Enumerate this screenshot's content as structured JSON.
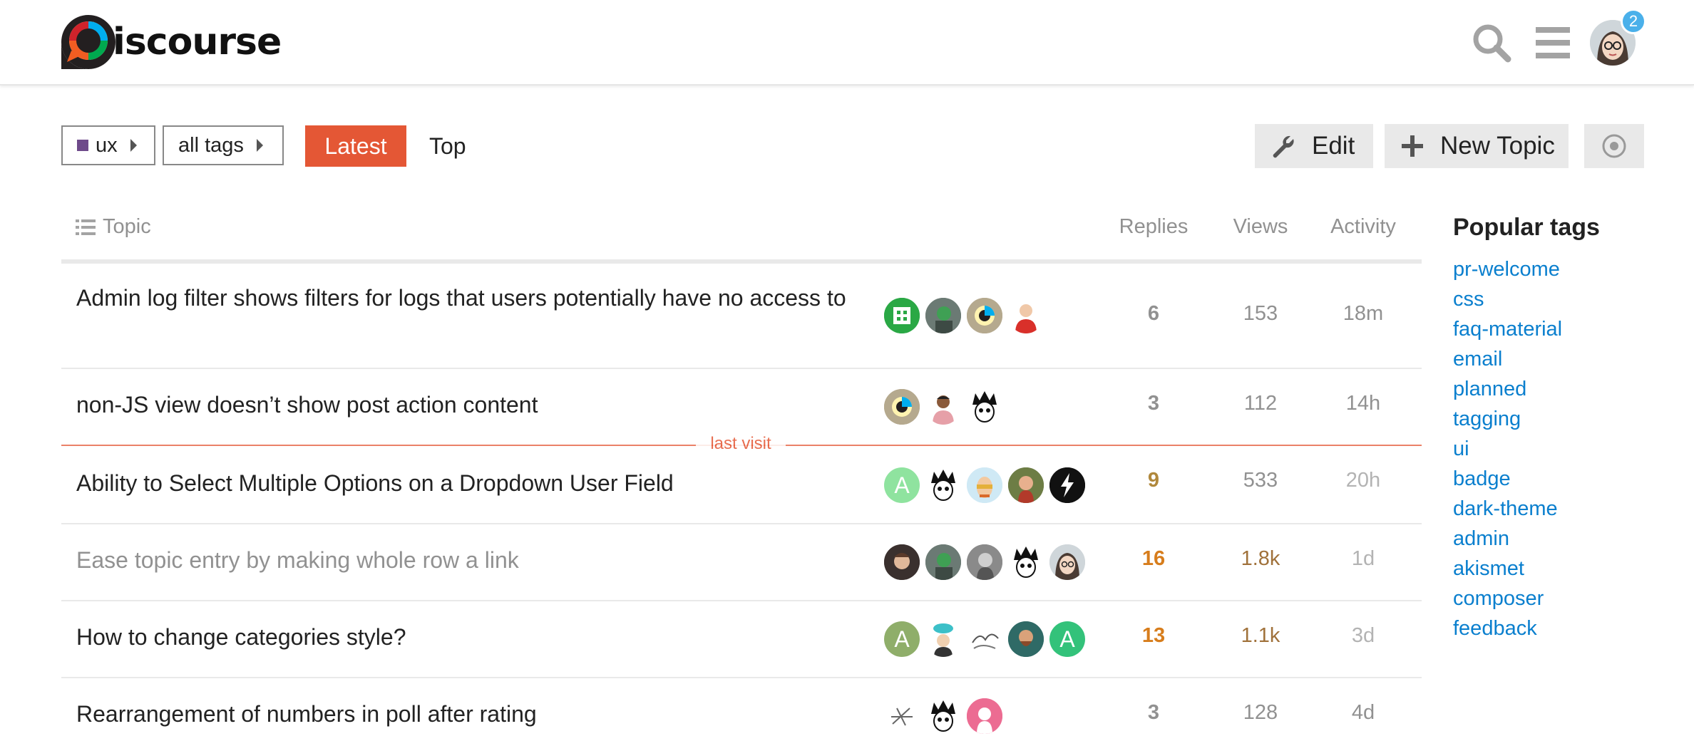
{
  "header": {
    "logo_text": "iscourse",
    "notification_count": "2",
    "icons": [
      "search-icon",
      "hamburger-menu-icon",
      "user-avatar"
    ]
  },
  "nav": {
    "category_filter": "ux",
    "category_color": "#6e4a8a",
    "tag_filter": "all tags",
    "tabs": [
      {
        "label": "Latest",
        "active": true
      },
      {
        "label": "Top",
        "active": false
      }
    ],
    "edit_label": "Edit",
    "new_topic_label": "New Topic"
  },
  "table": {
    "headers": {
      "topic": "Topic",
      "replies": "Replies",
      "views": "Views",
      "activity": "Activity"
    },
    "last_visit_label": "last visit",
    "rows": [
      {
        "title": "Admin log filter shows filters for logs that users potentially have no access to",
        "replies": "6",
        "views": "153",
        "activity": "18m"
      },
      {
        "title": "non-JS view doesn’t show post action content",
        "replies": "3",
        "views": "112",
        "activity": "14h"
      },
      {
        "title": "Ability to Select Multiple Options on a Dropdown User Field",
        "replies": "9",
        "views": "533",
        "activity": "20h"
      },
      {
        "title": "Ease topic entry by making whole row a link",
        "replies": "16",
        "views": "1.8k",
        "activity": "1d"
      },
      {
        "title": "How to change categories style?",
        "replies": "13",
        "views": "1.1k",
        "activity": "3d"
      },
      {
        "title": "Rearrangement of numbers in poll after rating",
        "replies": "3",
        "views": "128",
        "activity": "4d"
      }
    ]
  },
  "avatars": {
    "a": "A"
  },
  "sidebar": {
    "title": "Popular tags",
    "tags": [
      "pr-welcome",
      "css",
      "faq-material",
      "email",
      "planned",
      "tagging",
      "ui",
      "badge",
      "dark-theme",
      "admin",
      "akismet",
      "composer",
      "feedback"
    ]
  },
  "colors": {
    "accent": "#e45735",
    "link": "#0a7fce",
    "hot": "#d77d1c",
    "muted": "#919191"
  }
}
